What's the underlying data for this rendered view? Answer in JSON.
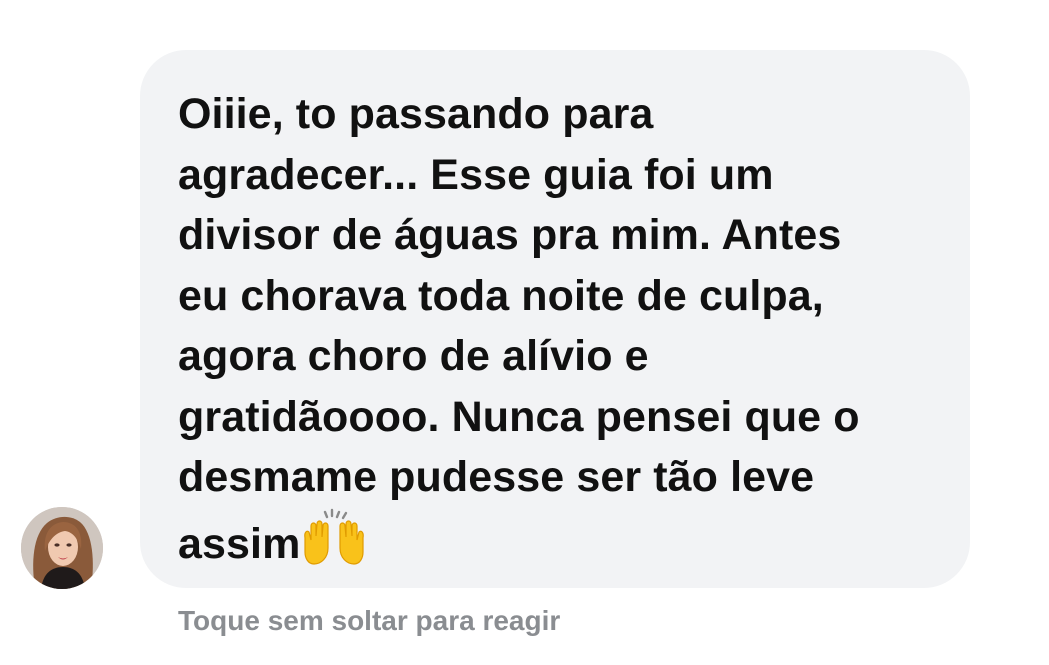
{
  "message": {
    "lines": [
      "Oiiie, to passando para",
      "agradecer... Esse guia foi um",
      "divisor de águas pra mim. Antes",
      "eu chorava toda noite de culpa,",
      "agora choro de alívio e",
      "gratidãoooo. Nunca pensei que o",
      "desmame pudesse ser tão leve",
      "assim"
    ],
    "emoji": "raising-hands-emoji"
  },
  "hint": "Toque sem soltar para reagir",
  "colors": {
    "bubble": "#f2f3f5",
    "text": "#111111",
    "hint": "#8a8d91"
  }
}
